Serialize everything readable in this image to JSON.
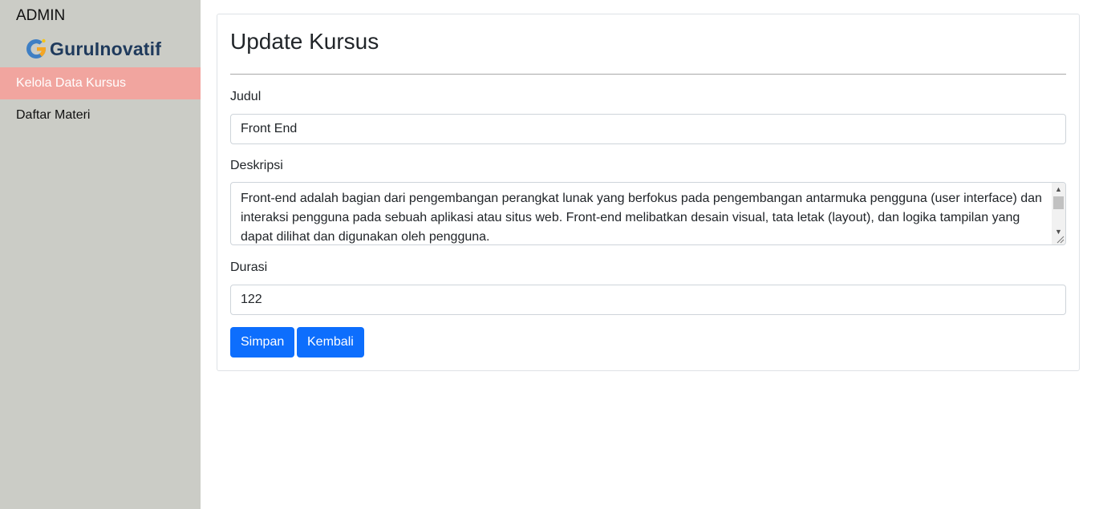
{
  "sidebar": {
    "title": "ADMIN",
    "logo": {
      "text": "GuruInovatif",
      "icon": "guruinovatif-logo-icon"
    },
    "items": [
      {
        "label": "Kelola Data Kursus",
        "active": true
      },
      {
        "label": "Daftar Materi",
        "active": false
      }
    ]
  },
  "form": {
    "title": "Update Kursus",
    "judul": {
      "label": "Judul",
      "value": "Front End"
    },
    "deskripsi": {
      "label": "Deskripsi",
      "value": "Front-end adalah bagian dari pengembangan perangkat lunak yang berfokus pada pengembangan antarmuka pengguna (user interface) dan interaksi pengguna pada sebuah aplikasi atau situs web. Front-end melibatkan desain visual, tata letak (layout), dan logika tampilan yang dapat dilihat dan digunakan oleh pengguna."
    },
    "durasi": {
      "label": "Durasi",
      "value": "122"
    },
    "buttons": {
      "save": "Simpan",
      "back": "Kembali"
    }
  },
  "colors": {
    "sidebar_bg": "#cbccc6",
    "active_item_bg": "#f1a59f",
    "primary_button": "#0d6efd",
    "logo_text": "#1f3a5c"
  }
}
